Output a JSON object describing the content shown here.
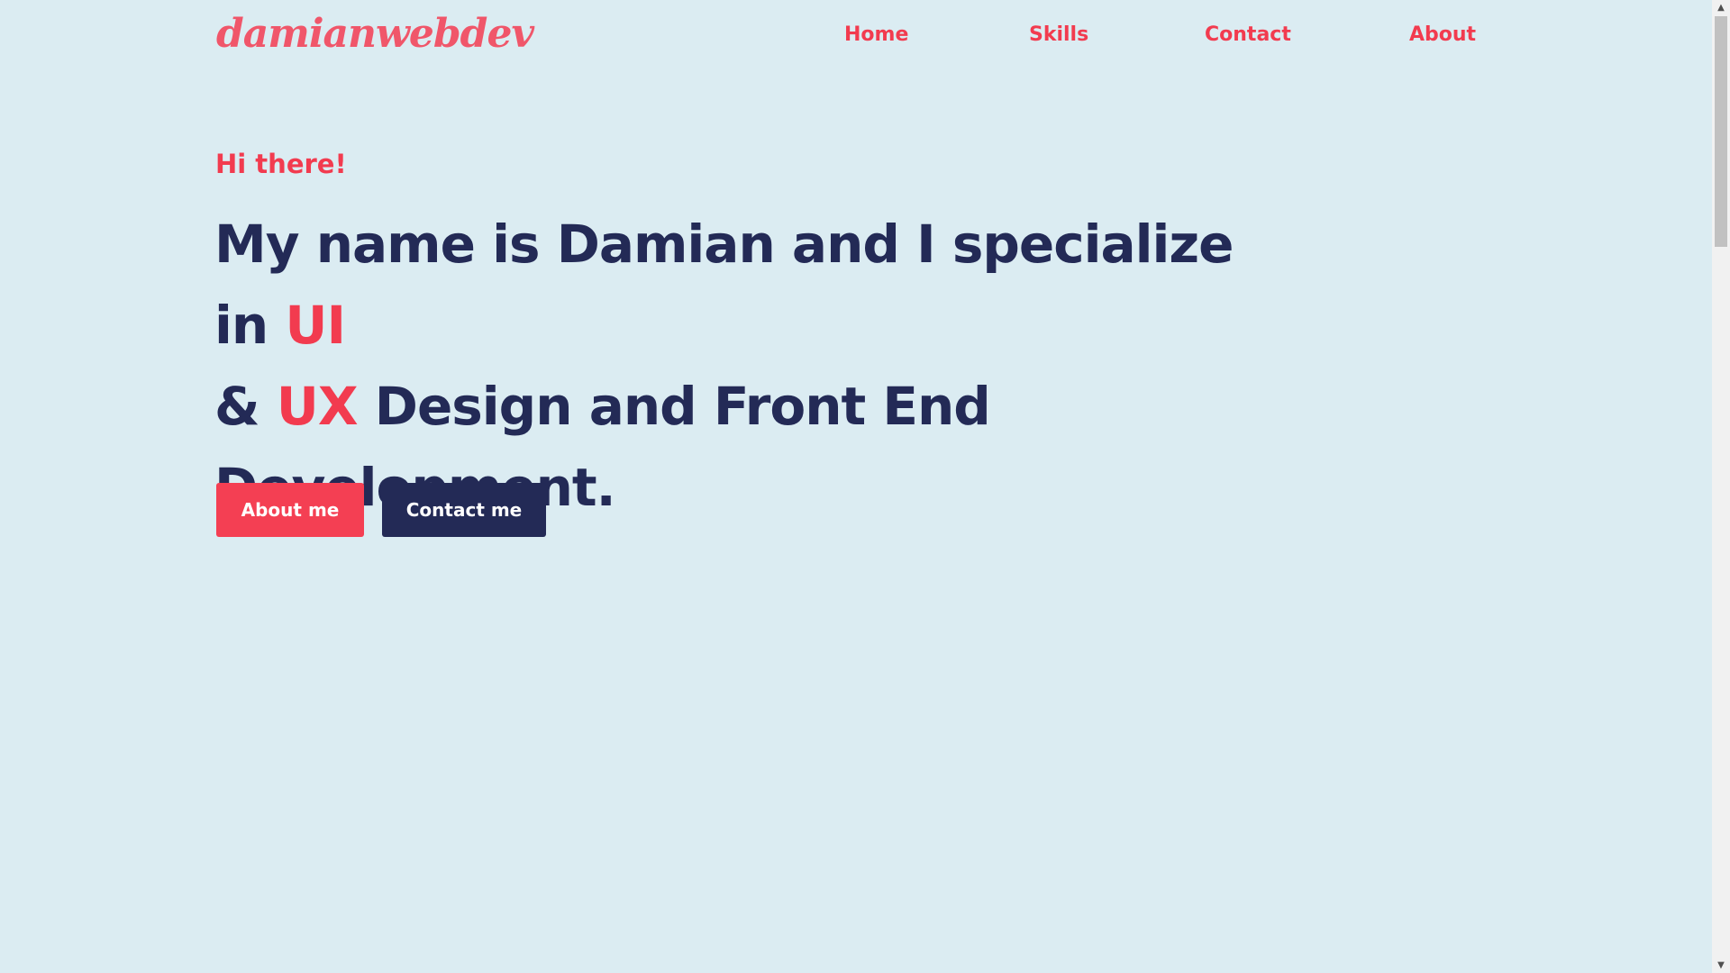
{
  "header": {
    "logo": "damianwebdev",
    "nav": [
      {
        "label": "Home"
      },
      {
        "label": "Skills"
      },
      {
        "label": "Contact"
      },
      {
        "label": "About"
      }
    ]
  },
  "hero": {
    "greeting": "Hi there!",
    "headline_parts": {
      "p1": "My name is Damian and I specialize in ",
      "accent1": "UI",
      "p2": " & ",
      "accent2": "UX",
      "p3": " Design and Front End Development."
    },
    "buttons": {
      "about": "About me",
      "contact": "Contact me"
    }
  },
  "scrollbar": {
    "up_icon": "▲",
    "down_icon": "▼"
  },
  "colors": {
    "background": "#dbecf2",
    "accent": "#f23b4f",
    "navy": "#232a56",
    "logo": "#f0566a"
  }
}
